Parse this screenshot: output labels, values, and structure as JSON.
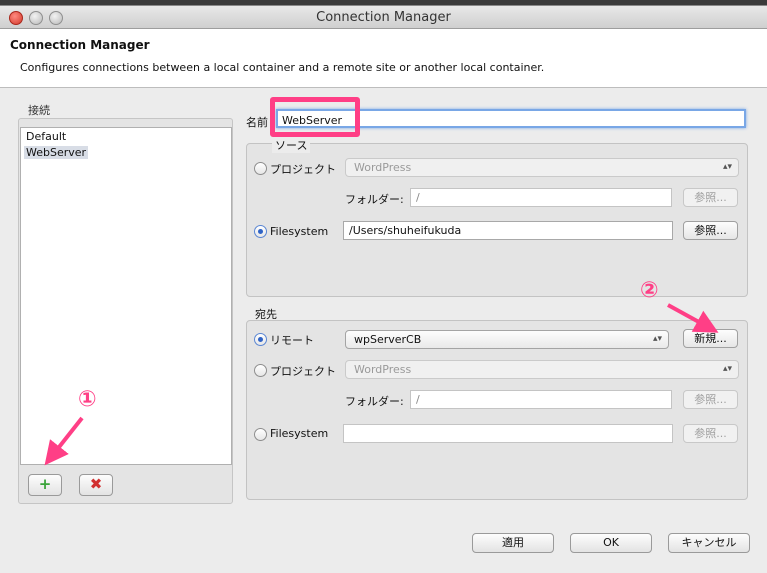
{
  "window": {
    "title": "Connection Manager"
  },
  "header": {
    "title": "Connection Manager",
    "description": "Configures connections between a local container and a remote site or another local container."
  },
  "left": {
    "group_label": "接続",
    "items": [
      "Default",
      "WebServer"
    ],
    "add_symbol": "+",
    "delete_symbol": "✖"
  },
  "name": {
    "label": "名前",
    "value": "WebServer"
  },
  "source": {
    "label": "ソース",
    "project_label": "プロジェクト",
    "project_value": "WordPress",
    "folder_label": "フォルダー:",
    "folder_value": "/",
    "browse_label": "参照...",
    "filesystem_label": "Filesystem",
    "filesystem_value": "/Users/shuheifukuda",
    "browse2_label": "参照..."
  },
  "destination": {
    "label": "宛先",
    "remote_label": "リモート",
    "remote_value": "wpServerCB",
    "new_label": "新規...",
    "project_label": "プロジェクト",
    "project_value": "WordPress",
    "folder_label": "フォルダー:",
    "folder_value": "/",
    "browse_label": "参照...",
    "filesystem_label": "Filesystem",
    "filesystem_value": "",
    "browse2_label": "参照..."
  },
  "footer": {
    "apply_label": "適用",
    "ok_label": "OK",
    "cancel_label": "キャンセル"
  },
  "annotations": {
    "one": "①",
    "two": "②"
  },
  "colors": {
    "highlight": "#ff3f86",
    "focus": "#79a7e6",
    "radio_on": "#2f63c6"
  }
}
